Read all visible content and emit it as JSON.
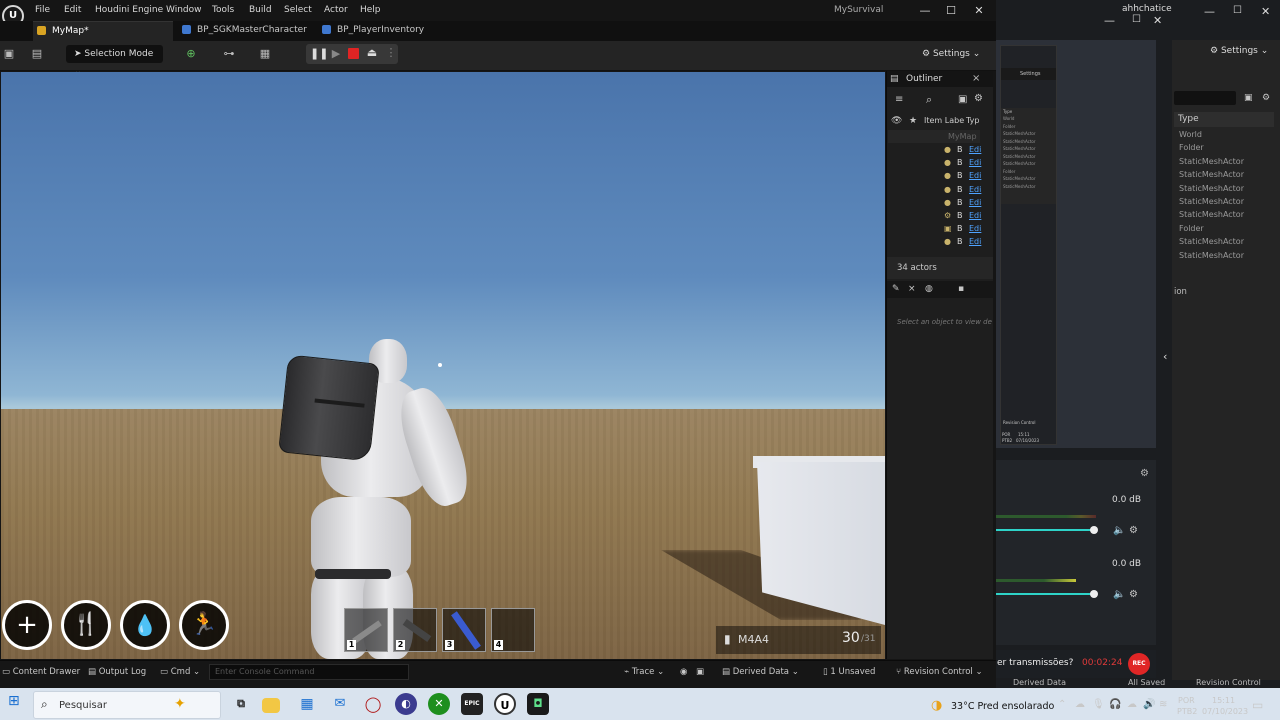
{
  "ue": {
    "menu": [
      "File",
      "Edit",
      "Houdini Engine",
      "Window",
      "Tools",
      "Build",
      "Select",
      "Actor",
      "Help"
    ],
    "project": "MySurvival",
    "window_controls": [
      "—",
      "☐",
      "✕"
    ],
    "tabs": [
      {
        "label": "MyMap*",
        "active": true
      },
      {
        "label": "BP_SGKMasterCharacter",
        "active": false
      },
      {
        "label": "BP_PlayerInventory",
        "active": false
      }
    ],
    "toolbar": {
      "selection_mode": "Selection Mode",
      "settings": "Settings"
    },
    "hud": {
      "circles": [
        "+",
        "🍴",
        "💧",
        "🏃"
      ],
      "slots": [
        "1",
        "2",
        "3",
        "4"
      ],
      "weapon": "M4A4",
      "ammo_current": "30",
      "ammo_total": "/31"
    },
    "outliner": {
      "title": "Outliner",
      "col_label": "Item Labe",
      "col_type": "Typ",
      "map_item": "MyMap",
      "rows": [
        "B",
        "B",
        "B",
        "B",
        "B",
        "B",
        "B",
        "B"
      ],
      "row_type": "Edi",
      "actor_count": "34 actors",
      "details_hint": "Select an object to view de"
    },
    "status": {
      "content_drawer": "Content Drawer",
      "output_log": "Output Log",
      "cmd": "Cmd",
      "console_placeholder": "Enter Console Command",
      "trace": "Trace",
      "derived_data": "Derived Data",
      "unsaved": "1 Unsaved",
      "revision_control": "Revision Control"
    }
  },
  "right": {
    "user": "ahhchatice",
    "settings": "Settings",
    "type_header": "Type",
    "types": [
      "World",
      "Folder",
      "StaticMeshActor",
      "StaticMeshActor",
      "StaticMeshActor",
      "StaticMeshActor",
      "StaticMeshActor",
      "Folder",
      "StaticMeshActor",
      "StaticMeshActor"
    ],
    "ion": "ion",
    "mini_settings": "Settings",
    "mini_type": "Type",
    "mini_types": [
      "World",
      "Folder",
      "StaticMeshActor",
      "StaticMeshActor",
      "StaticMeshActor",
      "StaticMeshActor",
      "StaticMeshActor",
      "Folder",
      "StaticMeshActor",
      "StaticMeshActor"
    ],
    "mini_status": [
      "POR",
      "PTB2",
      "15:11",
      "07/10/2023"
    ],
    "mini_rev": "Revision Control",
    "mixer": [
      "0.0 dB",
      "0.0 dB"
    ],
    "obs_question": "er transmissões?",
    "rec_time": "00:02:24",
    "rec_label": "REC",
    "ghost_derived": "Derived Data",
    "ghost_saved": "All Saved",
    "ghost_rev": "Revision Control"
  },
  "taskbar": {
    "search": "Pesquisar",
    "weather": "33°C  Pred ensolarado",
    "lang1": "POR",
    "lang2": "PTB2",
    "time": "15:11",
    "date": "07/10/2023"
  }
}
